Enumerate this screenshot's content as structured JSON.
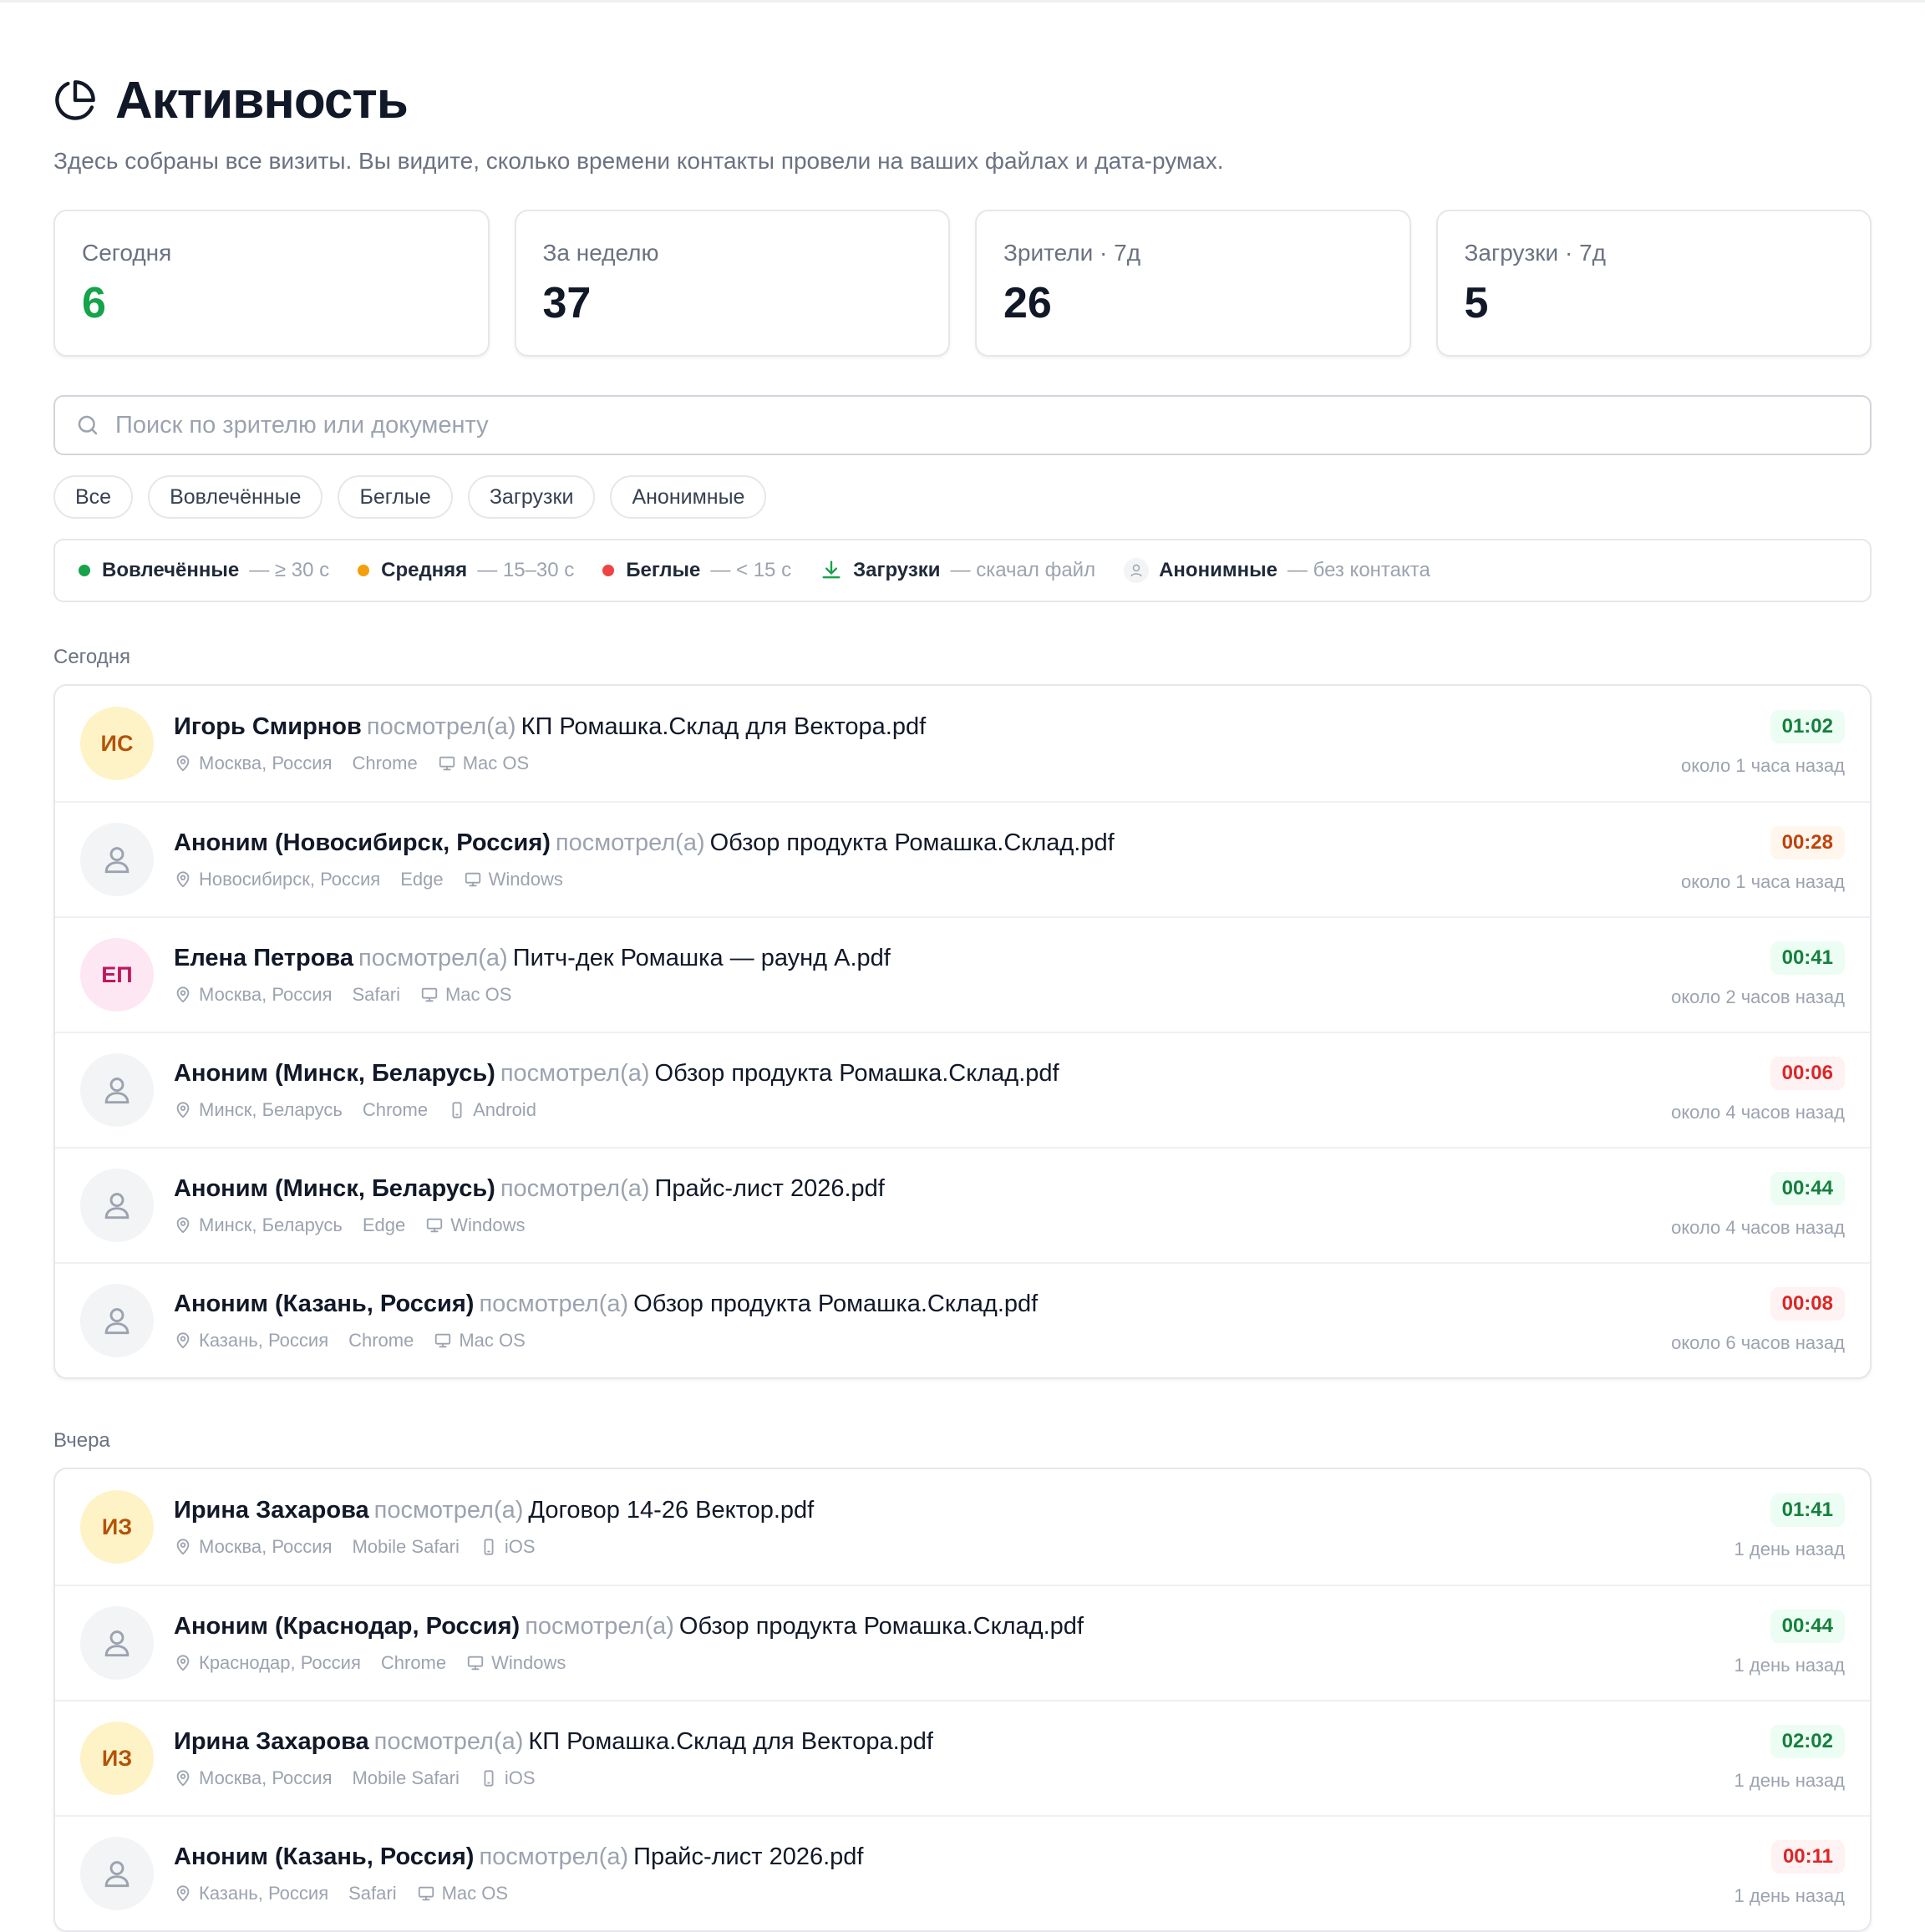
{
  "page": {
    "title": "Активность",
    "subtitle": "Здесь собраны все визиты. Вы видите, сколько времени контакты провели на ваших файлах и дата-румах."
  },
  "stats": [
    {
      "label": "Сегодня",
      "value": "6"
    },
    {
      "label": "За неделю",
      "value": "37"
    },
    {
      "label": "Зрители · 7д",
      "value": "26"
    },
    {
      "label": "Загрузки · 7д",
      "value": "5"
    }
  ],
  "search": {
    "placeholder": "Поиск по зрителю или документу"
  },
  "filters": [
    "Все",
    "Вовлечённые",
    "Беглые",
    "Загрузки",
    "Анонимные"
  ],
  "legend": [
    {
      "name": "Вовлечённые",
      "desc": "— ≥ 30 с",
      "color": "#16a34a"
    },
    {
      "name": "Средняя",
      "desc": "— 15–30 с",
      "color": "#f59e0b"
    },
    {
      "name": "Беглые",
      "desc": "— < 15 с",
      "color": "#ef4444"
    },
    {
      "name": "Загрузки",
      "desc": "— скачал файл"
    },
    {
      "name": "Анонимные",
      "desc": "— без контакта"
    }
  ],
  "verb": "посмотрел(а)",
  "sections": [
    {
      "title": "Сегодня",
      "rows": [
        {
          "initials": "ИС",
          "name": "Игорь Смирнов",
          "doc": "КП Ромашка.Склад для Вектора.pdf",
          "location": "Москва, Россия",
          "browser": "Chrome",
          "os": "Mac OS",
          "device": "desktop",
          "duration": "01:02",
          "ago": "около 1 часа назад"
        },
        {
          "initials": "",
          "name": "Аноним (Новосибирск, Россия)",
          "doc": "Обзор продукта Ромашка.Склад.pdf",
          "location": "Новосибирск, Россия",
          "browser": "Edge",
          "os": "Windows",
          "device": "desktop",
          "duration": "00:28",
          "ago": "около 1 часа назад"
        },
        {
          "initials": "ЕП",
          "name": "Елена Петрова",
          "doc": "Питч-дек Ромашка — раунд A.pdf",
          "location": "Москва, Россия",
          "browser": "Safari",
          "os": "Mac OS",
          "device": "desktop",
          "duration": "00:41",
          "ago": "около 2 часов назад"
        },
        {
          "initials": "",
          "name": "Аноним (Минск, Беларусь)",
          "doc": "Обзор продукта Ромашка.Склад.pdf",
          "location": "Минск, Беларусь",
          "browser": "Chrome",
          "os": "Android",
          "device": "mobile",
          "duration": "00:06",
          "ago": "около 4 часов назад"
        },
        {
          "initials": "",
          "name": "Аноним (Минск, Беларусь)",
          "doc": "Прайс-лист 2026.pdf",
          "location": "Минск, Беларусь",
          "browser": "Edge",
          "os": "Windows",
          "device": "desktop",
          "duration": "00:44",
          "ago": "около 4 часов назад"
        },
        {
          "initials": "",
          "name": "Аноним (Казань, Россия)",
          "doc": "Обзор продукта Ромашка.Склад.pdf",
          "location": "Казань, Россия",
          "browser": "Chrome",
          "os": "Mac OS",
          "device": "desktop",
          "duration": "00:08",
          "ago": "около 6 часов назад"
        }
      ]
    },
    {
      "title": "Вчера",
      "rows": [
        {
          "initials": "ИЗ",
          "name": "Ирина Захарова",
          "doc": "Договор 14-26 Вектор.pdf",
          "location": "Москва, Россия",
          "browser": "Mobile Safari",
          "os": "iOS",
          "device": "mobile",
          "duration": "01:41",
          "ago": "1 день назад"
        },
        {
          "initials": "",
          "name": "Аноним (Краснодар, Россия)",
          "doc": "Обзор продукта Ромашка.Склад.pdf",
          "location": "Краснодар, Россия",
          "browser": "Chrome",
          "os": "Windows",
          "device": "desktop",
          "duration": "00:44",
          "ago": "1 день назад"
        },
        {
          "initials": "ИЗ",
          "name": "Ирина Захарова",
          "doc": "КП Ромашка.Склад для Вектора.pdf",
          "location": "Москва, Россия",
          "browser": "Mobile Safari",
          "os": "iOS",
          "device": "mobile",
          "duration": "02:02",
          "ago": "1 день назад"
        },
        {
          "initials": "",
          "name": "Аноним (Казань, Россия)",
          "doc": "Прайс-лист 2026.pdf",
          "location": "Казань, Россия",
          "browser": "Safari",
          "os": "Mac OS",
          "device": "desktop",
          "duration": "00:11",
          "ago": "1 день назад"
        }
      ]
    }
  ]
}
